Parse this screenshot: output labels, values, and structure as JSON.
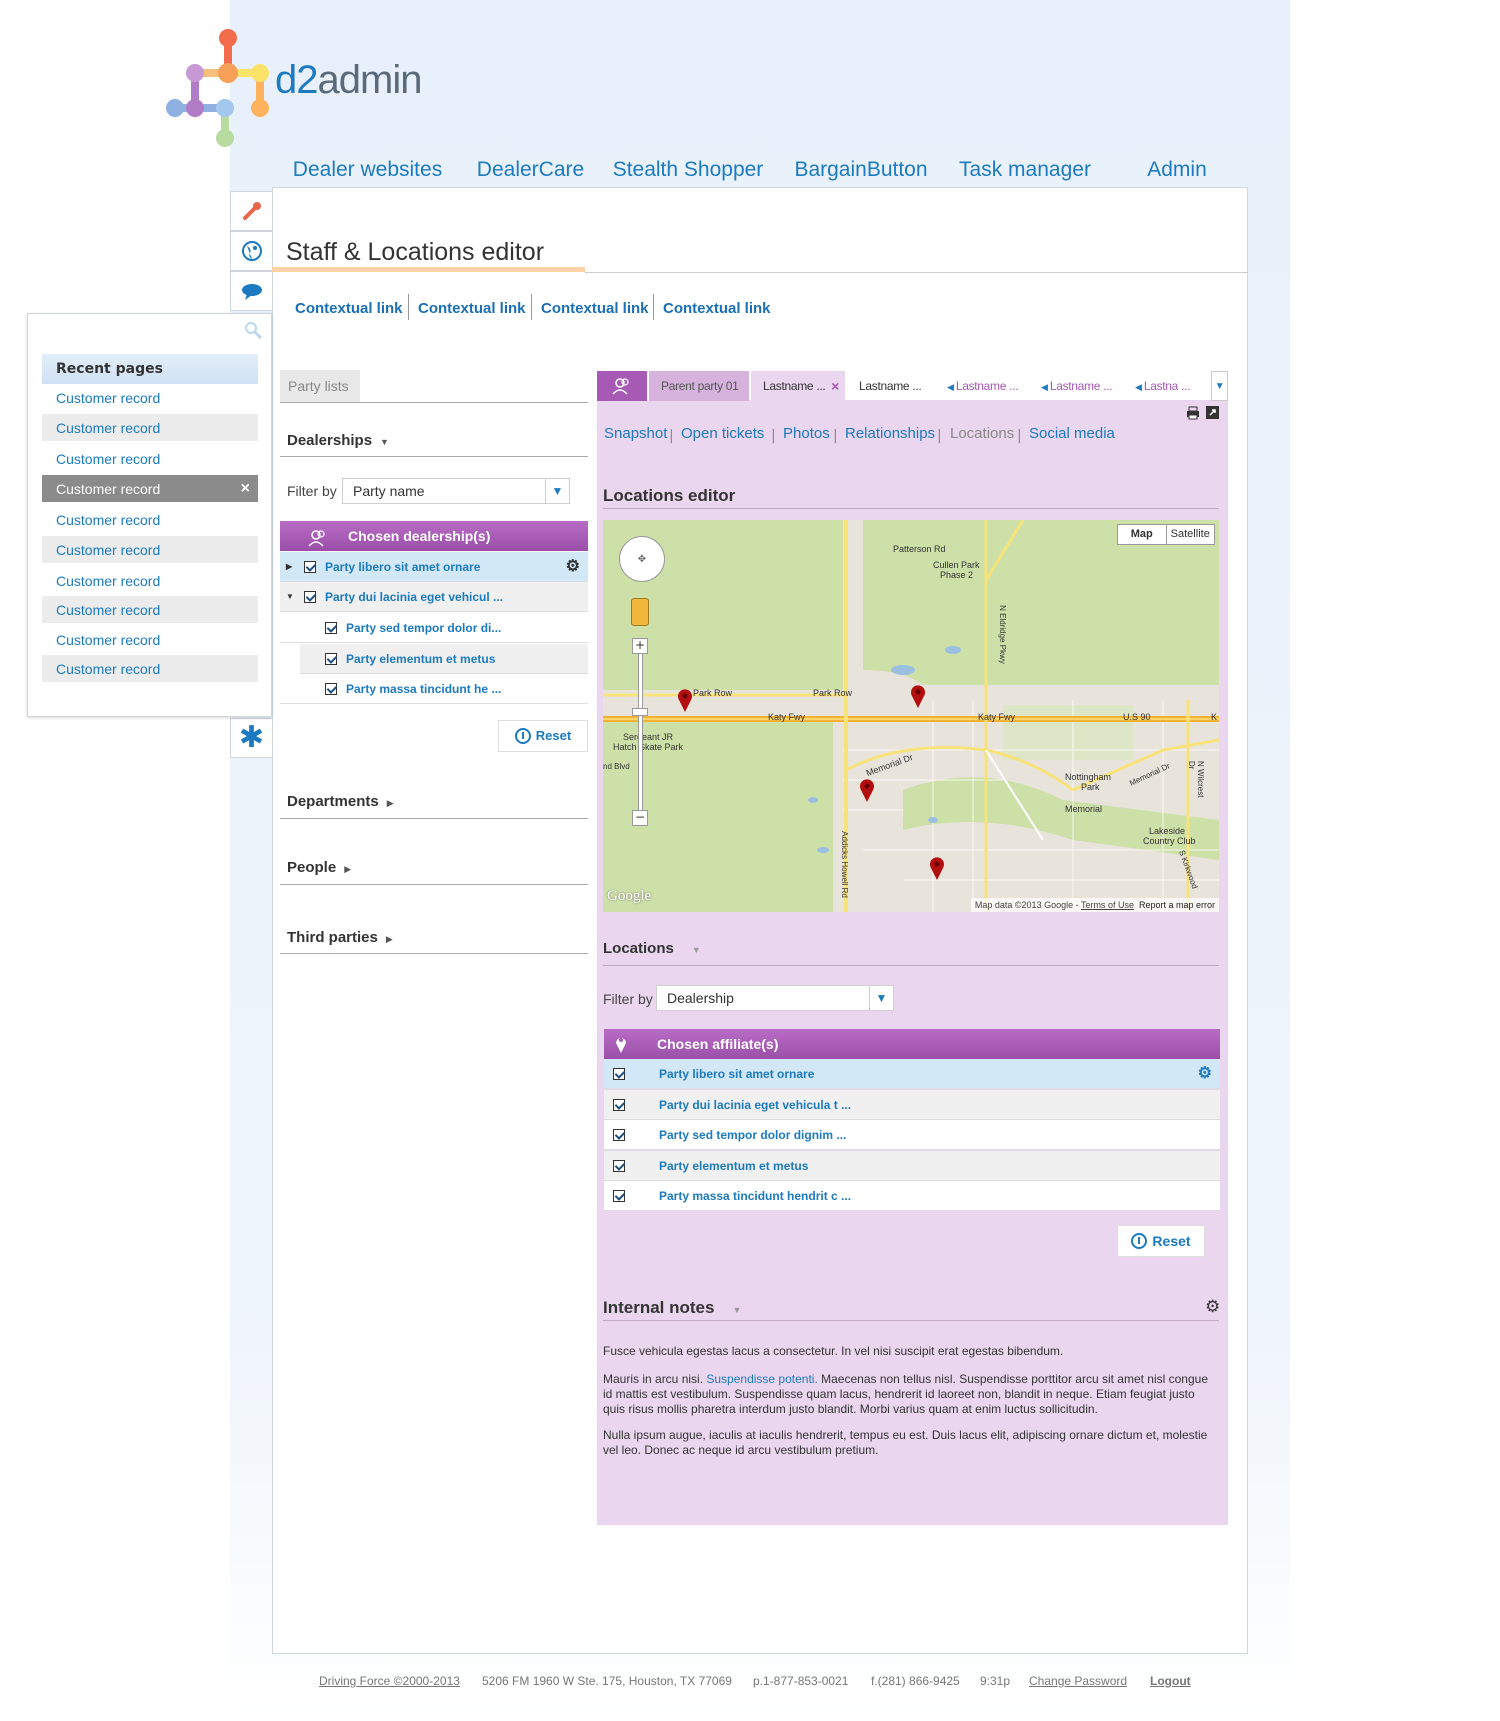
{
  "app": {
    "logo_main": "d2",
    "logo_sub": "admin"
  },
  "topnav": [
    {
      "label": "Dealer websites",
      "color": "#ffcf9e"
    },
    {
      "label": "DealerCare",
      "color": "#bfe3b4"
    },
    {
      "label": "Stealth Shopper",
      "color": "#b9d3ef"
    },
    {
      "label": "BargainButton",
      "color": "#fff17a"
    },
    {
      "label": "Task manager",
      "color": "#d9a9df"
    },
    {
      "label": "Admin",
      "color": "#f58b66"
    }
  ],
  "sidebar": {
    "recent_header": "Recent pages",
    "items": [
      "Customer record",
      "Customer record",
      "Customer record",
      "Customer record",
      "Customer record",
      "Customer record",
      "Customer record",
      "Customer record",
      "Customer record",
      "Customer record"
    ],
    "close": "×"
  },
  "page": {
    "title": "Staff & Locations editor"
  },
  "contextual_links": [
    "Contextual link",
    "Contextual link",
    "Contextual link",
    "Contextual link"
  ],
  "left": {
    "tab": "Party lists",
    "dealerships": "Dealerships",
    "filter_label": "Filter by",
    "filter_value": "Party name",
    "chosen_header": "Chosen dealership(s)",
    "rows": [
      "Party libero sit amet ornare",
      "Party dui lacinia eget vehicul ...",
      "Party sed tempor dolor di...",
      "Party elementum et metus",
      "Party massa tincidunt he ..."
    ],
    "reset": "Reset",
    "departments": "Departments",
    "people": "People",
    "third_parties": "Third parties"
  },
  "right": {
    "tabs": [
      "Parent party 01",
      "Lastname ...",
      "Lastname ...",
      "Lastname ...",
      "Lastname ...",
      "Lastna ..."
    ],
    "subnav": [
      "Snapshot",
      "Open tickets",
      "Photos",
      "Relationships",
      "Locations",
      "Social media"
    ],
    "sep": "|",
    "locations_editor": "Locations editor",
    "map_btn_map": "Map",
    "map_btn_sat": "Satellite",
    "map_credit": "Map data ©2013 Google -",
    "map_terms": "Terms of Use",
    "map_report": "Report a map error",
    "map_google": "Google",
    "map_labels": [
      "Patterson Rd",
      "Cullen Park",
      "Phase 2",
      "Park Row",
      "Park Row",
      "Katy Fwy",
      "Katy Fwy",
      "U.S 90",
      "Sergeant JR",
      "Hatch Skate Park",
      "nd Blvd",
      "Memorial Dr",
      "Nottingham",
      "Park",
      "Memorial",
      "Memorial Dr",
      "Lakeside",
      "Country Club",
      "N Eldridge Pkwy",
      "Addicks Howell Rd",
      "N Wilcrest Dr",
      "S Kirkwood",
      "K"
    ],
    "locations": "Locations",
    "filter_label": "Filter by",
    "filter_value": "Dealership",
    "chosen_header": "Chosen affiliate(s)",
    "rows": [
      "Party libero sit amet ornare",
      "Party dui lacinia eget vehicula t ...",
      "Party sed tempor dolor dignim  ...",
      "Party elementum et metus",
      "Party massa tincidunt hendrit  c ..."
    ],
    "reset": "Reset",
    "notes_header": "Internal notes",
    "notes_p1": "Fusce vehicula egestas lacus a consectetur. In vel nisi suscipit erat egestas bibendum.",
    "notes_p2a": "Mauris in arcu nisi. ",
    "notes_p2_link": "Suspendisse potenti.",
    "notes_p2b": " Maecenas non tellus nisl. Suspendisse porttitor arcu sit amet nisl congue id mattis est vestibulum. Suspendisse quam lacus, hendrerit id laoreet non, blandit in neque. Etiam feugiat justo quis risus mollis pharetra interdum justo blandit. Morbi varius quam at enim luctus sollicitudin.",
    "notes_p3": "Nulla ipsum augue, iaculis at iaculis hendrerit, tempus eu est. Duis lacus elit, adipiscing ornare dictum et, molestie vel leo. Donec ac neque id arcu vestibulum pretium."
  },
  "footer": {
    "copyright": "Driving Force ©2000-2013",
    "address": "5206 FM 1960 W Ste. 175, Houston, TX 77069",
    "phone": "p.1-877-853-0021",
    "fax": "f.(281) 866-9425",
    "time": "9:31p",
    "change_password": "Change Password",
    "logout": "Logout"
  },
  "colors": {
    "accent": "#1c7ac0",
    "purple": "#a65ab4",
    "panel_purple": "#ead6ee"
  }
}
